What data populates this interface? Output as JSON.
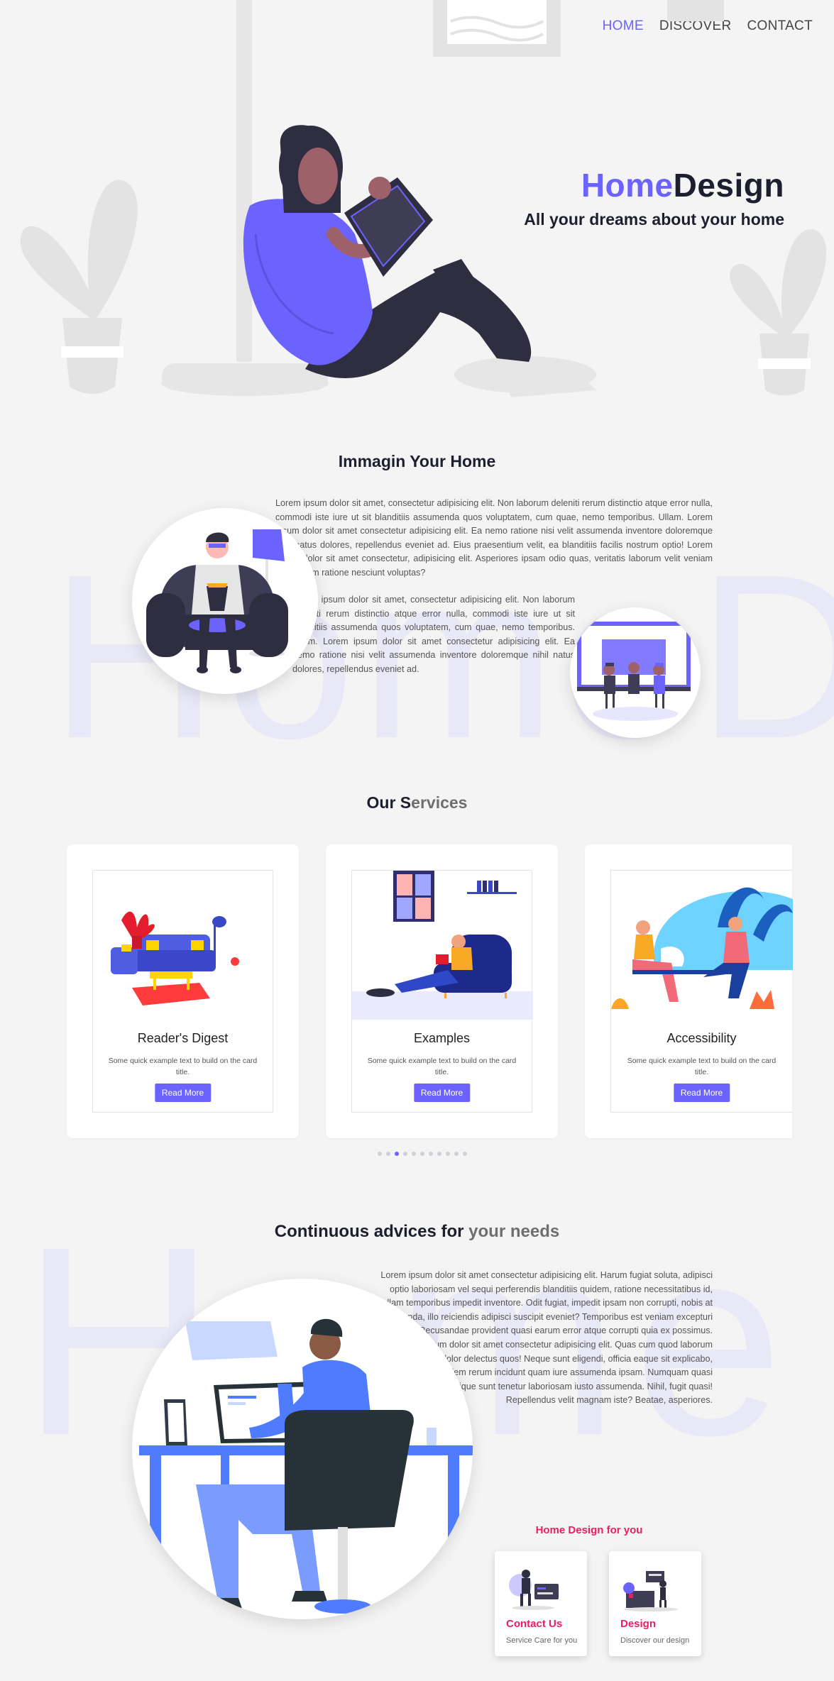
{
  "nav": {
    "items": [
      {
        "label": "HOME",
        "active": true
      },
      {
        "label": "DISCOVER",
        "active": false
      },
      {
        "label": "CONTACT",
        "active": false
      }
    ]
  },
  "hero": {
    "title_part1": "Home",
    "title_part2": "Design",
    "subtitle": "All your dreams about your home"
  },
  "imagine": {
    "title": "Immagin Your Home",
    "paragraph_1": "Lorem ipsum dolor sit amet, consectetur adipisicing elit. Non laborum deleniti rerum distinctio atque error nulla, commodi iste iure ut sit blanditiis assumenda quos voluptatem, cum quae, nemo temporibus. Ullam. Lorem ipsum dolor sit amet consectetur adipisicing elit. Ea nemo ratione nisi velit assumenda inventore doloremque nihil natus dolores, repellendus eveniet ad. Eius praesentium velit, ea blanditiis facilis nostrum optio! Lorem ipsum dolor sit amet consectetur, adipisicing elit. Asperiores ipsam odio quas, veritatis laborum velit veniam voluptatem ratione nesciunt voluptas?",
    "paragraph_2": "Lorem ipsum dolor sit amet, consectetur adipisicing elit. Non laborum deleniti rerum distinctio atque error nulla, commodi iste iure ut sit blanditiis assumenda quos voluptatem, cum quae, nemo temporibus. Ullam. Lorem ipsum dolor sit amet consectetur adipisicing elit. Ea nemo ratione nisi velit assumenda inventore doloremque nihil natus dolores, repellendus eveniet ad.",
    "watermark": "HomeD"
  },
  "services": {
    "title_part1": "Our S",
    "title_part2": "ervices",
    "cards": [
      {
        "title": "Reader's Digest",
        "text": "Some quick example text to build on the card title.",
        "button": "Read More"
      },
      {
        "title": "Examples",
        "text": "Some quick example text to build on the card title.",
        "button": "Read More"
      },
      {
        "title": "Accessibility",
        "text": "Some quick example text to build on the card title.",
        "button": "Read More"
      }
    ],
    "dots_total": 11,
    "dots_active_index": 2
  },
  "advices": {
    "title_part1": "Continuous advices for ",
    "title_part2": "your needs",
    "paragraph": "Lorem ipsum dolor sit amet consectetur adipisicing elit. Harum fugiat soluta, adipisci optio laboriosam vel sequi perferendis blanditiis quidem, ratione necessitatibus id, ullam temporibus impedit inventore. Odit fugiat, impedit ipsam non corrupti, nobis at assumenda, illo reiciendis adipisci suscipit eveniet? Temporibus est veniam excepturi optio! Recusandae provident quasi earum error atque corrupti quia ex possimus. Lorem ipsum dolor sit amet consectetur adipisicing elit. Quas cum quod laborum voluptates iure dolor delectus quos! Neque sunt eligendi, officia eaque sit explicabo, deserunt quidem rerum incidunt quam iure assumenda ipsam. Numquam quasi perferendis similique sunt tenetur laboriosam iusto assumenda. Nihil, fugit quasi! Repellendus velit magnam iste? Beatae, asperiores.",
    "watermark": "Home",
    "for_you_label": "Home Design for you",
    "mini_cards": [
      {
        "title": "Contact Us",
        "text": "Service Care for you"
      },
      {
        "title": "Design",
        "text": "Discover our design"
      }
    ]
  },
  "colors": {
    "accent": "#6c63ff",
    "dark": "#1d1f2e",
    "pink": "#e91e63",
    "background": "#f4f4f4"
  }
}
